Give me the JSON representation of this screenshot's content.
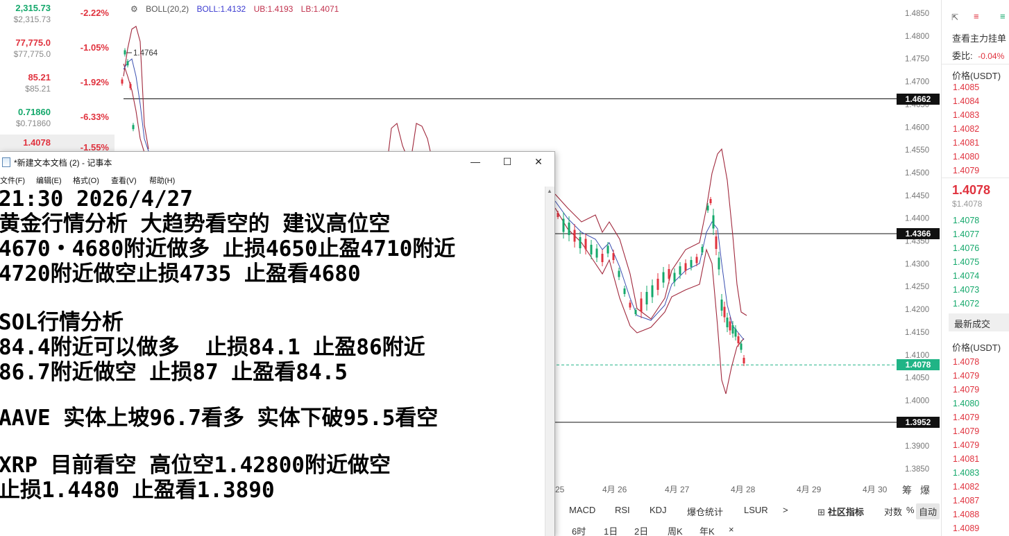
{
  "watchlist": [
    {
      "price": "2,315.73",
      "sub": "$2,315.73",
      "change": "-2.22%",
      "color": "green"
    },
    {
      "price": "77,775.0",
      "sub": "$77,775.0",
      "change": "-1.05%",
      "color": "red"
    },
    {
      "price": "85.21",
      "sub": "$85.21",
      "change": "-1.92%",
      "color": "red"
    },
    {
      "price": "0.71860",
      "sub": "$0.71860",
      "change": "-6.33%",
      "color": "green"
    },
    {
      "price": "1.4078",
      "sub": "",
      "change": "-1.55%",
      "color": "red"
    }
  ],
  "chart": {
    "boll_label": "BOLL(20,2)",
    "boll_mid": "BOLL:1.4132",
    "boll_ub": "UB:1.4193",
    "boll_lb": "LB:1.4071",
    "high_marker": "1.4764",
    "y_ticks": [
      "1.4850",
      "1.4800",
      "1.4750",
      "1.4700",
      "1.4650",
      "1.4600",
      "1.4550",
      "1.4500",
      "1.4450",
      "1.4400",
      "1.4350",
      "1.4300",
      "1.4250",
      "1.4200",
      "1.4150",
      "1.4100",
      "1.4050",
      "1.4000",
      "1.3950",
      "1.3900",
      "1.3850"
    ],
    "x_ticks": [
      "25",
      "4月 26",
      "4月 27",
      "4月 28",
      "4月 29",
      "4月 30"
    ],
    "hlines": [
      {
        "price": 1.4662,
        "label": "1.4662"
      },
      {
        "price": 1.4366,
        "label": "1.4366"
      },
      {
        "price": 1.3952,
        "label": "1.3952"
      }
    ],
    "current_price": {
      "price": 1.4078,
      "label": "1.4078"
    },
    "right_corner_labels": [
      "筹",
      "爆"
    ]
  },
  "chart_data": {
    "type": "line",
    "ylim": [
      1.382,
      1.488
    ],
    "series": [
      {
        "segment": "left",
        "x": [
          0,
          4,
          8,
          12,
          16,
          20,
          24,
          28,
          32,
          36
        ],
        "values": [
          1.47,
          1.4764,
          1.474,
          1.469,
          1.46,
          1.45,
          1.44,
          1.43,
          1.42,
          1.415
        ]
      },
      {
        "segment": "mid",
        "x": [
          388,
          396,
          404,
          412,
          420,
          428,
          436,
          444,
          452
        ],
        "values": [
          1.458,
          1.46,
          1.456,
          1.462,
          1.461,
          1.458,
          1.459,
          1.457,
          1.454
        ]
      }
    ]
  },
  "indicator_bar": {
    "items": [
      "MACD",
      "RSI",
      "KDJ",
      "爆仓统计",
      "LSUR",
      ">"
    ],
    "community": "社区指标",
    "log": "对数",
    "pct": "%",
    "auto": "自动"
  },
  "period_bar": {
    "items": [
      "6时",
      "1日",
      "2日",
      "周K",
      "年K",
      "×"
    ]
  },
  "book": {
    "header": "查看主力挂单",
    "ratio_label": "委比:",
    "ratio_value": "-0.04%",
    "price_header": "价格(USDT)",
    "asks": [
      "1.4085",
      "1.4084",
      "1.4083",
      "1.4082",
      "1.4081",
      "1.4080",
      "1.4079"
    ],
    "last_price": "1.4078",
    "last_price_usd": "$1.4078",
    "bids": [
      "1.4078",
      "1.4077",
      "1.4076",
      "1.4075",
      "1.4074",
      "1.4073",
      "1.4072"
    ],
    "trades_tab": "最新成交",
    "trades_header": "价格(USDT)",
    "trades": [
      {
        "p": "1.4078",
        "c": "red"
      },
      {
        "p": "1.4079",
        "c": "red"
      },
      {
        "p": "1.4079",
        "c": "red"
      },
      {
        "p": "1.4080",
        "c": "green"
      },
      {
        "p": "1.4079",
        "c": "red"
      },
      {
        "p": "1.4079",
        "c": "red"
      },
      {
        "p": "1.4079",
        "c": "red"
      },
      {
        "p": "1.4081",
        "c": "red"
      },
      {
        "p": "1.4083",
        "c": "green"
      },
      {
        "p": "1.4082",
        "c": "red"
      },
      {
        "p": "1.4087",
        "c": "red"
      },
      {
        "p": "1.4088",
        "c": "red"
      },
      {
        "p": "1.4089",
        "c": "red"
      }
    ]
  },
  "notepad": {
    "title": "*新建文本文档 (2) - 记事本",
    "min": "—",
    "max": "☐",
    "close": "✕",
    "menu": [
      "文件(F)",
      "编辑(E)",
      "格式(O)",
      "查看(V)",
      "帮助(H)"
    ],
    "lines": [
      "21:30 2026/4/27",
      "黄金行情分析 大趋势看空的 建议高位空",
      "4670・4680附近做多 止损4650止盈4710附近",
      "4720附近做空止损4735 止盈看4680",
      "",
      "SOL行情分析",
      "84.4附近可以做多  止损84.1 止盈86附近",
      "86.7附近做空 止损87 止盈看84.5",
      "",
      "AAVE 实体上坡96.7看多 实体下破95.5看空",
      "",
      "XRP 目前看空 高位空1.42800附近做空",
      "止损1.4480 止盈看1.3890"
    ]
  }
}
